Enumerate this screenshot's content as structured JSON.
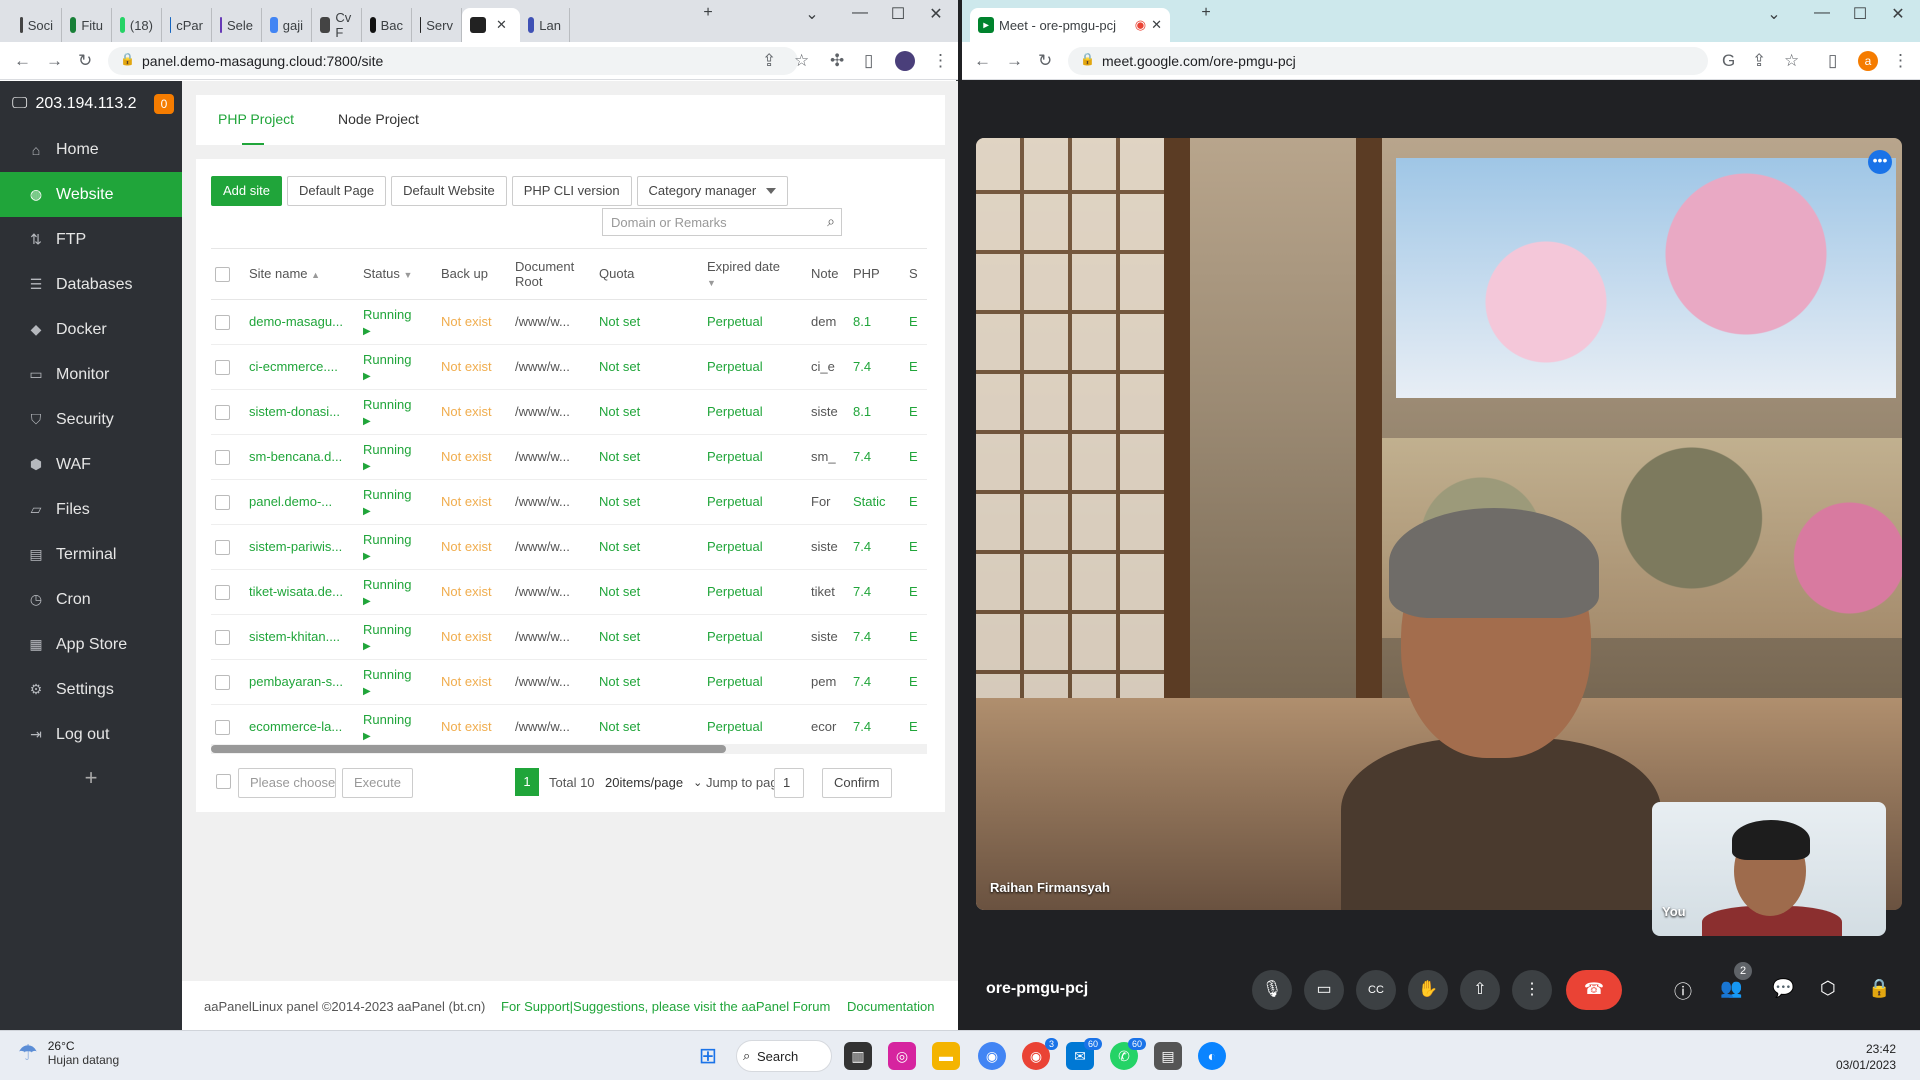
{
  "left_browser": {
    "tabs": [
      {
        "label": "Soci",
        "color": "#444"
      },
      {
        "label": "Fitu",
        "color": "#188038"
      },
      {
        "label": "(18)",
        "color": "#25d366"
      },
      {
        "label": "cPar",
        "color": "#1565c0"
      },
      {
        "label": "Sele",
        "color": "#673ab7"
      },
      {
        "label": "gaji",
        "color": "#4285f4"
      },
      {
        "label": "Cv F",
        "color": "#444"
      },
      {
        "label": "Bac",
        "color": "#111"
      },
      {
        "label": "Serv",
        "color": "#222"
      },
      {
        "label": "",
        "color": "#222"
      },
      {
        "label": "Lan",
        "color": "#3f51b5"
      }
    ],
    "url": "panel.demo-masagung.cloud:7800/site"
  },
  "sidebar": {
    "ip": "203.194.113.2",
    "badge": "0",
    "items": [
      {
        "label": "Home",
        "icon": "home-icon",
        "glyph": "⌂"
      },
      {
        "label": "Website",
        "icon": "globe-icon",
        "glyph": "◍",
        "active": true
      },
      {
        "label": "FTP",
        "icon": "ftp-icon",
        "glyph": "⇅"
      },
      {
        "label": "Databases",
        "icon": "database-icon",
        "glyph": "☰"
      },
      {
        "label": "Docker",
        "icon": "docker-icon",
        "glyph": "◆"
      },
      {
        "label": "Monitor",
        "icon": "monitor-icon",
        "glyph": "▭"
      },
      {
        "label": "Security",
        "icon": "shield-icon",
        "glyph": "⛉"
      },
      {
        "label": "WAF",
        "icon": "waf-shield-icon",
        "glyph": "⬢"
      },
      {
        "label": "Files",
        "icon": "folder-icon",
        "glyph": "▱"
      },
      {
        "label": "Terminal",
        "icon": "terminal-icon",
        "glyph": "▤"
      },
      {
        "label": "Cron",
        "icon": "clock-icon",
        "glyph": "◷"
      },
      {
        "label": "App Store",
        "icon": "grid-icon",
        "glyph": "▦"
      },
      {
        "label": "Settings",
        "icon": "gear-icon",
        "glyph": "⚙"
      },
      {
        "label": "Log out",
        "icon": "logout-icon",
        "glyph": "⇥"
      }
    ],
    "plus": "+"
  },
  "main": {
    "tabs": [
      {
        "label": "PHP Project"
      },
      {
        "label": "Node Project"
      }
    ],
    "buttons": {
      "add_site": "Add site",
      "default_page": "Default Page",
      "default_website": "Default Website",
      "php_cli": "PHP CLI version",
      "category_manager": "Category manager"
    },
    "search_placeholder": "Domain or Remarks",
    "columns": [
      "Site name",
      "Status",
      "Back up",
      "Document Root",
      "Quota",
      "Expired date",
      "Note",
      "PHP",
      "S"
    ],
    "rows": [
      {
        "site": "demo-masagu...",
        "status": "Running",
        "backup": "Not exist",
        "root": "/www/w...",
        "quota": "Not set",
        "expired": "Perpetual",
        "note": "dem",
        "php": "8.1",
        "s": "E"
      },
      {
        "site": "ci-ecmmerce....",
        "status": "Running",
        "backup": "Not exist",
        "root": "/www/w...",
        "quota": "Not set",
        "expired": "Perpetual",
        "note": "ci_e",
        "php": "7.4",
        "s": "E"
      },
      {
        "site": "sistem-donasi...",
        "status": "Running",
        "backup": "Not exist",
        "root": "/www/w...",
        "quota": "Not set",
        "expired": "Perpetual",
        "note": "siste",
        "php": "8.1",
        "s": "E"
      },
      {
        "site": "sm-bencana.d...",
        "status": "Running",
        "backup": "Not exist",
        "root": "/www/w...",
        "quota": "Not set",
        "expired": "Perpetual",
        "note": "sm_",
        "php": "7.4",
        "s": "E"
      },
      {
        "site": "panel.demo-...",
        "status": "Running",
        "backup": "Not exist",
        "root": "/www/w...",
        "quota": "Not set",
        "expired": "Perpetual",
        "note": "For",
        "php": "Static",
        "s": "E"
      },
      {
        "site": "sistem-pariwis...",
        "status": "Running",
        "backup": "Not exist",
        "root": "/www/w...",
        "quota": "Not set",
        "expired": "Perpetual",
        "note": "siste",
        "php": "7.4",
        "s": "E"
      },
      {
        "site": "tiket-wisata.de...",
        "status": "Running",
        "backup": "Not exist",
        "root": "/www/w...",
        "quota": "Not set",
        "expired": "Perpetual",
        "note": "tiket",
        "php": "7.4",
        "s": "E"
      },
      {
        "site": "sistem-khitan....",
        "status": "Running",
        "backup": "Not exist",
        "root": "/www/w...",
        "quota": "Not set",
        "expired": "Perpetual",
        "note": "siste",
        "php": "7.4",
        "s": "E"
      },
      {
        "site": "pembayaran-s...",
        "status": "Running",
        "backup": "Not exist",
        "root": "/www/w...",
        "quota": "Not set",
        "expired": "Perpetual",
        "note": "pem",
        "php": "7.4",
        "s": "E"
      },
      {
        "site": "ecommerce-la...",
        "status": "Running",
        "backup": "Not exist",
        "root": "/www/w...",
        "quota": "Not set",
        "expired": "Perpetual",
        "note": "ecor",
        "php": "7.4",
        "s": "E"
      }
    ],
    "pager": {
      "please_choose": "Please choose",
      "execute": "Execute",
      "page": "1",
      "total": "Total 10",
      "per_page": "20items/page",
      "jump_label": "Jump to page",
      "jump_value": "1",
      "confirm": "Confirm"
    },
    "footer": {
      "copyright": "aaPanelLinux panel ©2014-2023 aaPanel (bt.cn)",
      "support": "For Support|Suggestions, please visit the aaPanel Forum",
      "docs": "Documentation"
    }
  },
  "right_browser": {
    "tab_title": "Meet - ore-pmgu-pcj",
    "url": "meet.google.com/ore-pmgu-pcj",
    "profile_initial": "a",
    "participant_name": "Raihan Firmansyah",
    "self_label": "You",
    "meeting_code": "ore-pmgu-pcj",
    "participant_count": "2"
  },
  "taskbar": {
    "temp": "26°C",
    "weather": "Hujan datang",
    "search": "Search",
    "badges": {
      "chrome2": "3",
      "mail": "60",
      "whatsapp": "60"
    },
    "time": "23:42",
    "date": "03/01/2023"
  }
}
